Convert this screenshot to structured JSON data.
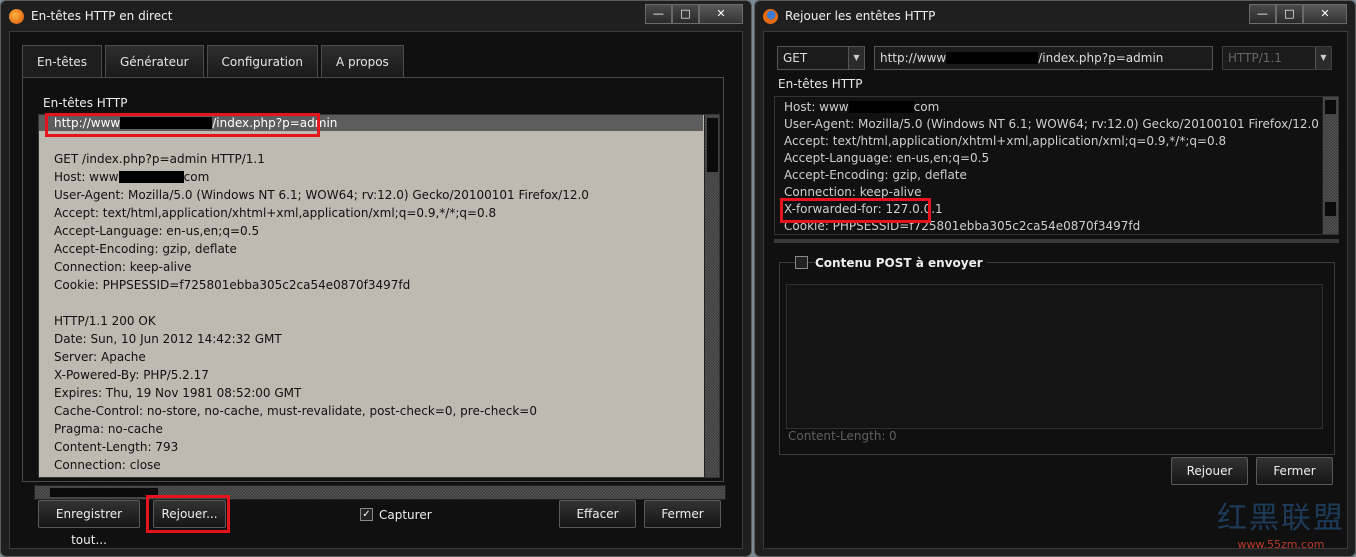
{
  "window_a": {
    "title": "En-têtes HTTP en direct",
    "tabs": [
      "En-têtes",
      "Générateur",
      "Configuration",
      "A propos"
    ],
    "pane_title": "En-têtes HTTP",
    "url_prefix": "http://www",
    "url_suffix": "/index.php?p=admin",
    "request_lines": [
      "GET /index.php?p=admin HTTP/1.1",
      "Host: www",
      "User-Agent: Mozilla/5.0 (Windows NT 6.1; WOW64; rv:12.0) Gecko/20100101 Firefox/12.0",
      "Accept: text/html,application/xhtml+xml,application/xml;q=0.9,*/*;q=0.8",
      "Accept-Language: en-us,en;q=0.5",
      "Accept-Encoding: gzip, deflate",
      "Connection: keep-alive",
      "Cookie: PHPSESSID=f725801ebba305c2ca54e0870f3497fd"
    ],
    "host_suffix": "com",
    "response_lines": [
      "HTTP/1.1 200 OK",
      "Date: Sun, 10 Jun 2012 14:42:32 GMT",
      "Server: Apache",
      "X-Powered-By: PHP/5.2.17",
      "Expires: Thu, 19 Nov 1981 08:52:00 GMT",
      "Cache-Control: no-store, no-cache, must-revalidate, post-check=0, pre-check=0",
      "Pragma: no-cache",
      "Content-Length: 793",
      "Connection: close"
    ],
    "buttons": {
      "save_all": "Enregistrer tout...",
      "replay": "Rejouer...",
      "capture": "Capturer",
      "clear": "Effacer",
      "close": "Fermer"
    },
    "capture_checked": true
  },
  "window_b": {
    "title": "Rejouer les entêtes HTTP",
    "method": "GET",
    "url_prefix": "http://www",
    "url_suffix": "/index.php?p=admin",
    "protocol": "HTTP/1.1",
    "headers_label": "En-têtes HTTP",
    "header_lines": [
      "Host: www",
      "User-Agent: Mozilla/5.0 (Windows NT 6.1; WOW64; rv:12.0) Gecko/20100101 Firefox/12.0",
      "Accept: text/html,application/xhtml+xml,application/xml;q=0.9,*/*;q=0.8",
      "Accept-Language: en-us,en;q=0.5",
      "Accept-Encoding: gzip, deflate",
      "Connection: keep-alive",
      "X-forwarded-for: 127.0.0.1",
      "Cookie: PHPSESSID=f725801ebba305c2ca54e0870f3497fd"
    ],
    "host_suffix": "com",
    "post_label": "Contenu POST à envoyer",
    "post_checked": false,
    "content_length_label": "Content-Length:",
    "content_length_value": "0",
    "buttons": {
      "replay": "Rejouer",
      "close": "Fermer"
    }
  },
  "watermark": {
    "big": "红黑联盟",
    "small": "www.55zm.com"
  },
  "colors": {
    "highlight": "#e8141c",
    "text_area_bg": "#bdbab2",
    "window_bg": "#1f1f1f"
  },
  "icons": {
    "window_a_icon": "live-http-headers-icon",
    "window_b_icon": "firefox-icon"
  }
}
